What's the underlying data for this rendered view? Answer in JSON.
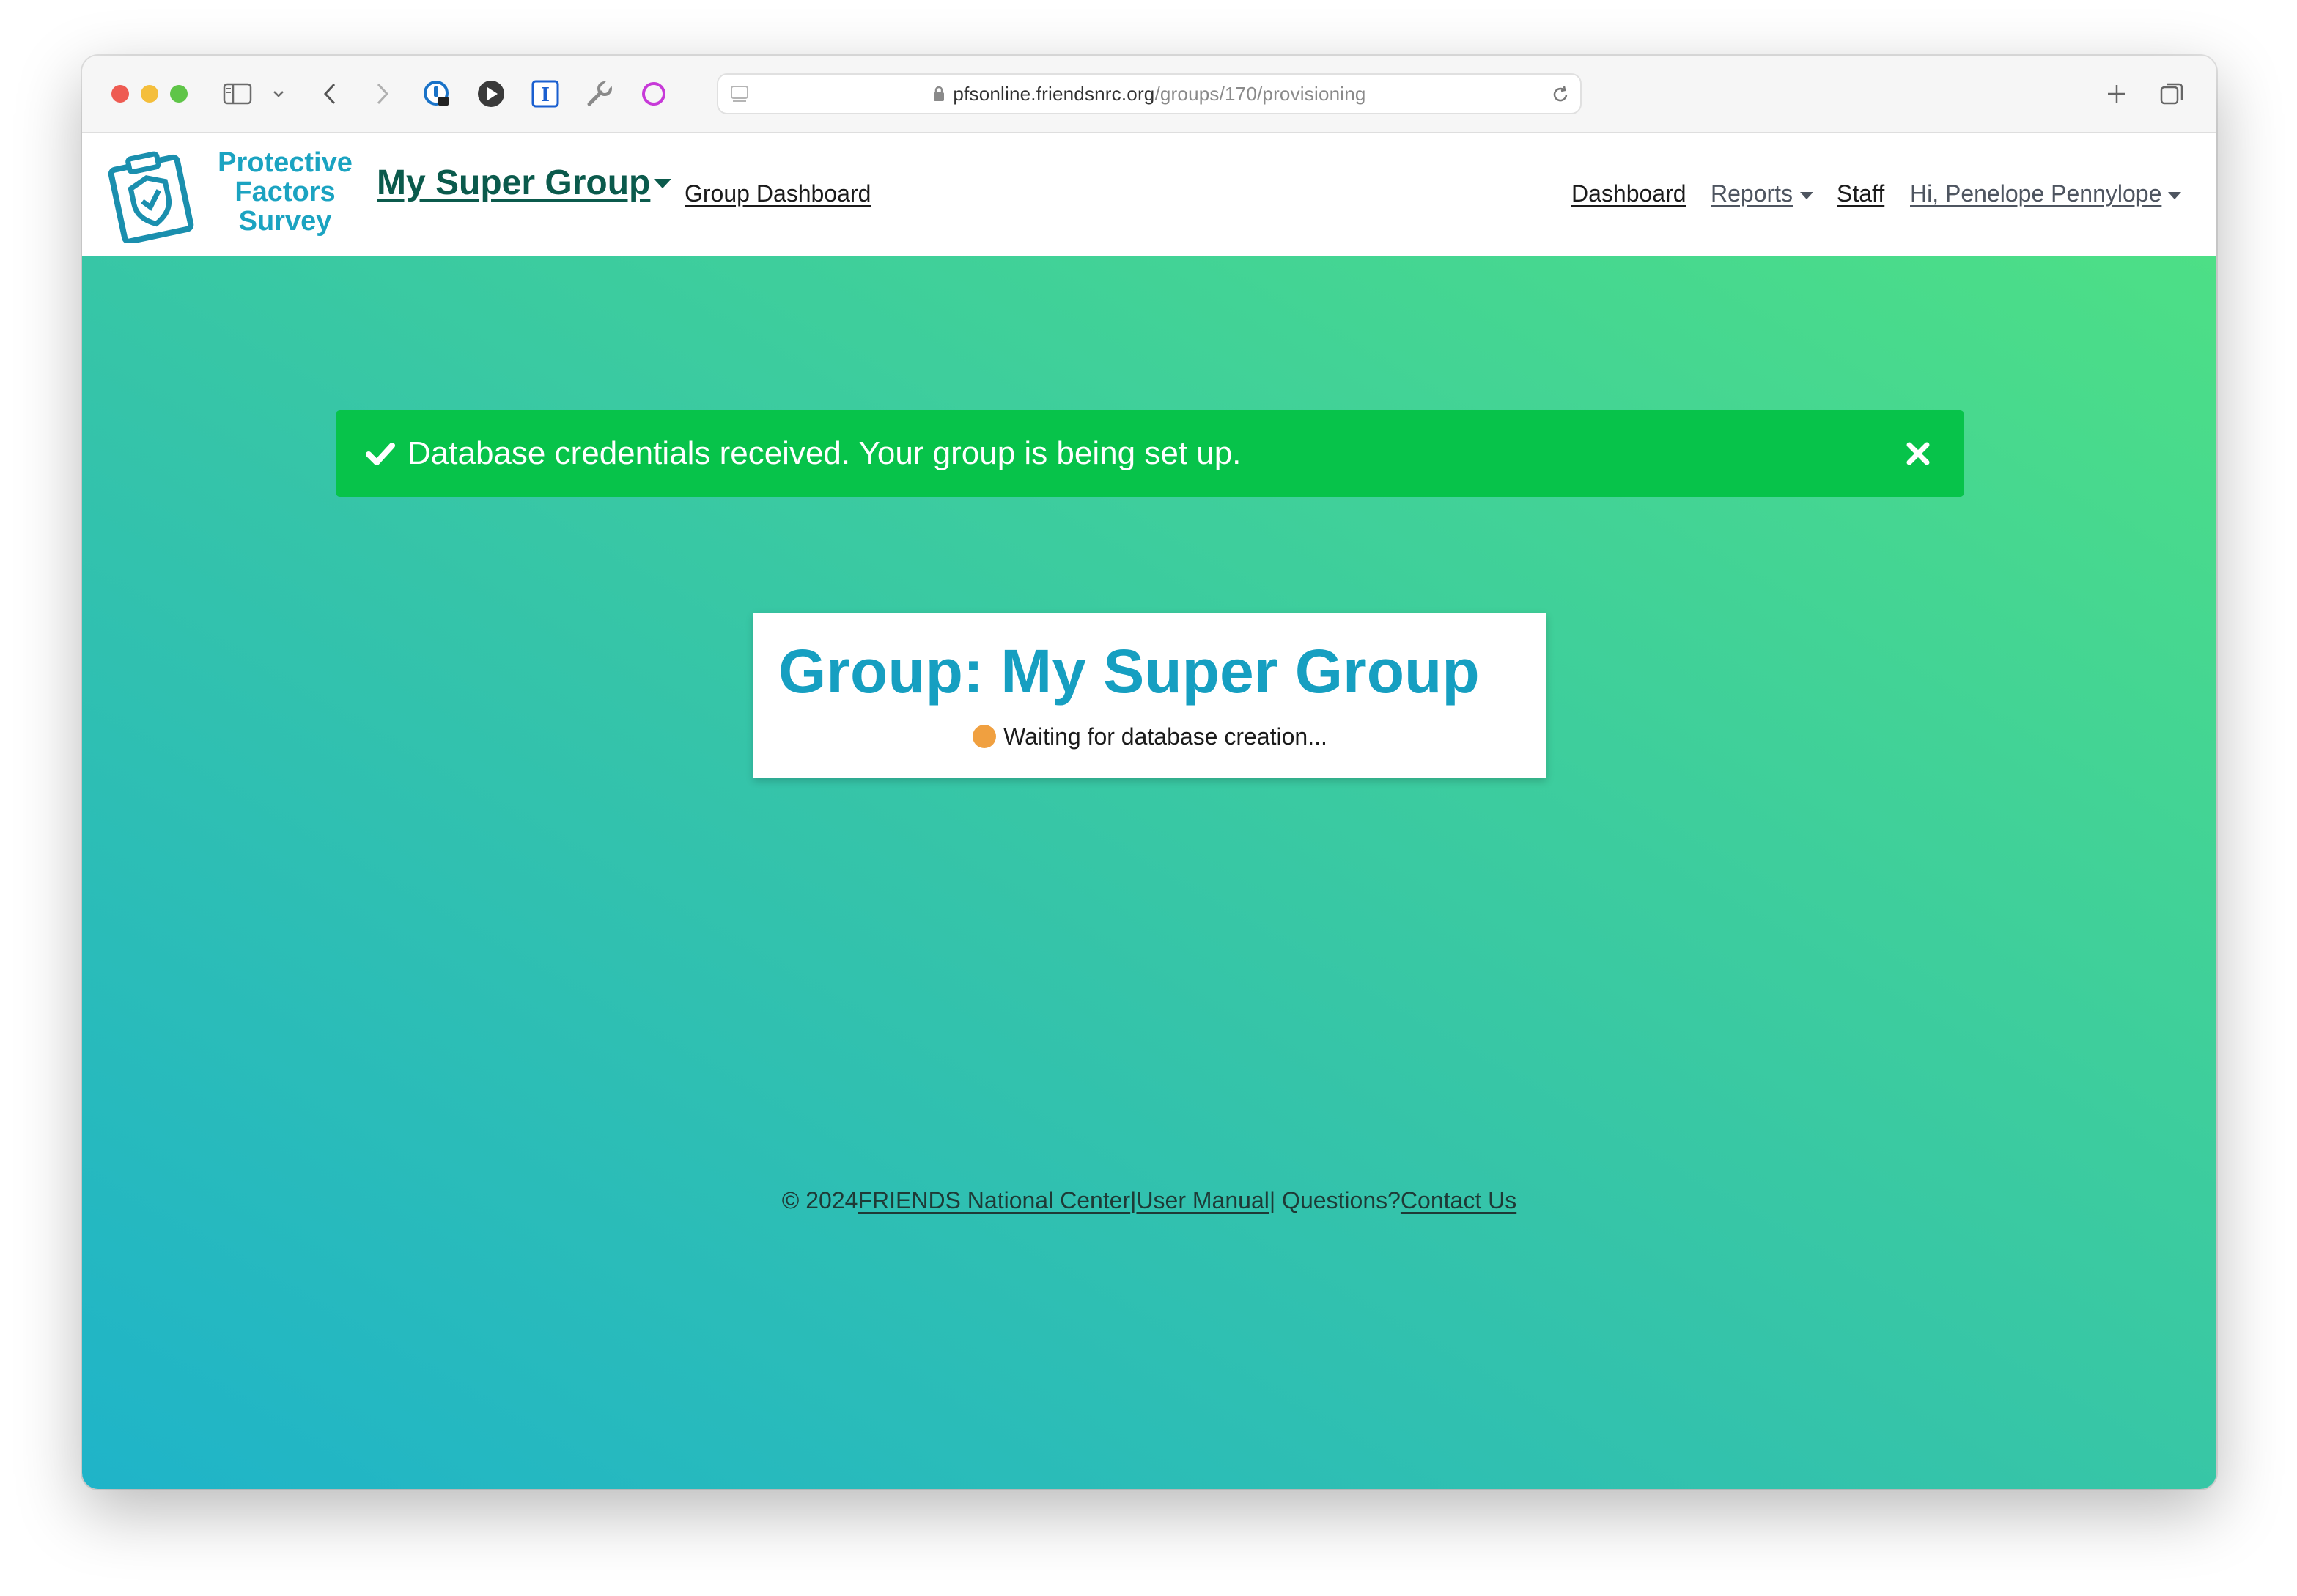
{
  "browser": {
    "url_host": "pfsonline.friendsnrc.org",
    "url_path": "/groups/170/provisioning"
  },
  "logo": {
    "line1": "Protective",
    "line2": "Factors",
    "line3": "Survey"
  },
  "nav": {
    "group_name": "My Super Group",
    "group_dashboard": "Group Dashboard",
    "dashboard": "Dashboard",
    "reports": "Reports",
    "staff": "Staff",
    "user_greeting": "Hi, Penelope Pennylope"
  },
  "alert": {
    "message": "Database credentials received. Your group is being set up.",
    "color": "#07c34a"
  },
  "card": {
    "title": "Group: My Super Group",
    "status": "Waiting for database creation..."
  },
  "footer": {
    "copyright": "© 2024",
    "org_link": "FRIENDS National Center",
    "sep1": "|",
    "manual_link": "User Manual",
    "sep2": "| Questions?",
    "contact_link": "Contact Us"
  },
  "colors": {
    "brand_teal": "#169fc1",
    "group_title": "#0b5a4c",
    "status_pending": "#f0a040"
  }
}
